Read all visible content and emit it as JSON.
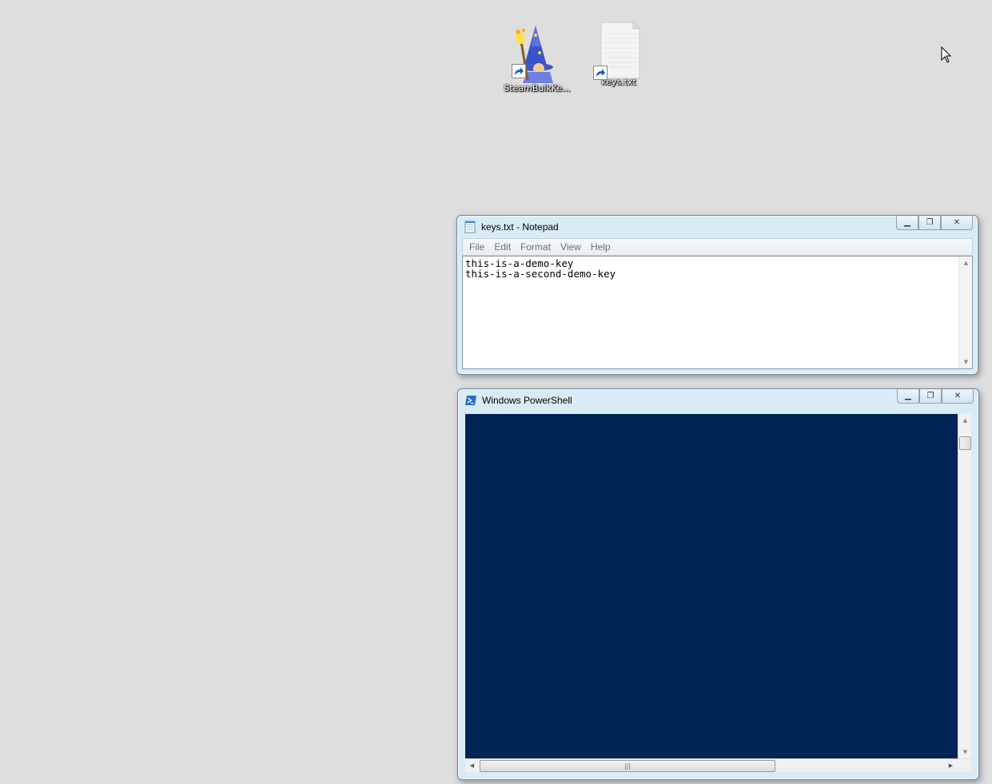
{
  "desktop": {
    "icons": [
      {
        "label": "SteamBulkKe...",
        "icon": "wizard-icon"
      },
      {
        "label": "keys.txt",
        "icon": "text-file-icon"
      }
    ]
  },
  "notepad": {
    "title": "keys.txt - Notepad",
    "menu": [
      "File",
      "Edit",
      "Format",
      "View",
      "Help"
    ],
    "content": "this-is-a-demo-key\nthis-is-a-second-demo-key"
  },
  "powershell": {
    "title": "Windows PowerShell"
  },
  "colors": {
    "console_bg": "#012456",
    "window_frame": "#d9ecf5",
    "desktop_bg": "#dedede"
  }
}
